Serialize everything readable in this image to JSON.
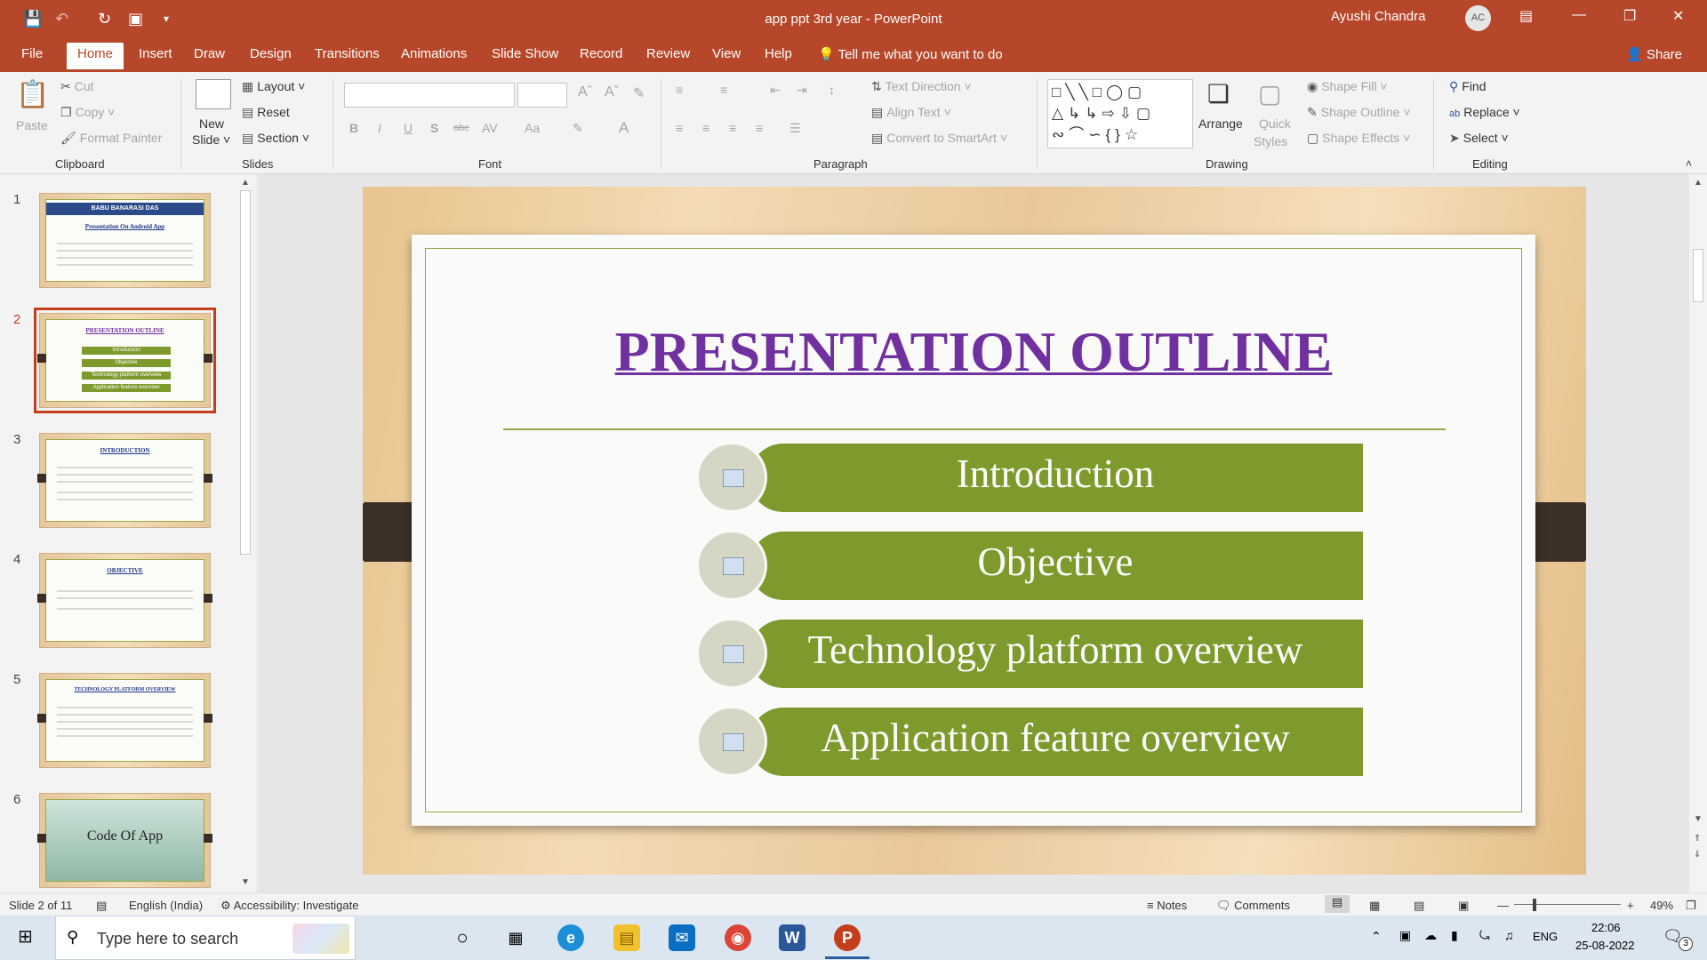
{
  "window": {
    "title": "app ppt 3rd year  -  PowerPoint",
    "user": "Ayushi Chandra",
    "initials": "AC"
  },
  "tabs": [
    "File",
    "Home",
    "Insert",
    "Draw",
    "Design",
    "Transitions",
    "Animations",
    "Slide Show",
    "Record",
    "Review",
    "View",
    "Help"
  ],
  "tellme": "Tell me what you want to do",
  "share": "Share",
  "ribbon": {
    "clipboard": {
      "paste": "Paste",
      "cut": "Cut",
      "copy": "Copy",
      "format_painter": "Format Painter",
      "label": "Clipboard"
    },
    "slides": {
      "new_slide_1": "New",
      "new_slide_2": "Slide",
      "layout": "Layout",
      "reset": "Reset",
      "section": "Section",
      "label": "Slides"
    },
    "font": {
      "label": "Font"
    },
    "paragraph": {
      "text_direction": "Text Direction",
      "align_text": "Align Text",
      "convert_smartart": "Convert to SmartArt",
      "label": "Paragraph"
    },
    "drawing": {
      "arrange": "Arrange",
      "quick_1": "Quick",
      "quick_2": "Styles",
      "shape_fill": "Shape Fill",
      "shape_outline": "Shape Outline",
      "shape_effects": "Shape Effects",
      "label": "Drawing"
    },
    "editing": {
      "find": "Find",
      "replace": "Replace",
      "select": "Select",
      "label": "Editing"
    }
  },
  "thumbnails": [
    {
      "n": "1",
      "title": "BABU BANARASI DAS",
      "sub": "Presentation On Android App"
    },
    {
      "n": "2",
      "title": "PRESENTATION OUTLINE",
      "items": [
        "Introduction",
        "Objective",
        "Technology platform overview",
        "Application feature overview"
      ]
    },
    {
      "n": "3",
      "title": "INTRODUCTION"
    },
    {
      "n": "4",
      "title": "OBJECTIVE"
    },
    {
      "n": "5",
      "title": "TECHNOLOGY PLATFORM OVERVIEW"
    },
    {
      "n": "6",
      "title": "Code Of App"
    }
  ],
  "slide": {
    "title": "PRESENTATION OUTLINE",
    "items": [
      "Introduction",
      "Objective",
      "Technology platform overview",
      "Application feature overview"
    ]
  },
  "status": {
    "slide": "Slide 2 of 11",
    "language": "English (India)",
    "accessibility": "Accessibility: Investigate",
    "notes": "Notes",
    "comments": "Comments",
    "zoom": "49%"
  },
  "taskbar": {
    "search": "Type here to search",
    "lang": "ENG",
    "time": "22:06",
    "date": "25-08-2022",
    "notif": "3"
  }
}
